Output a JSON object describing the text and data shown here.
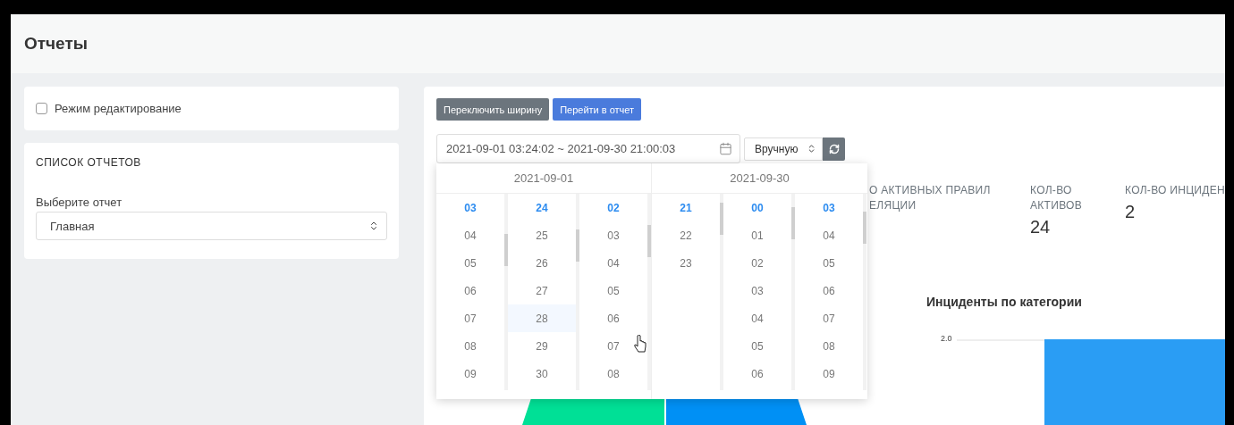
{
  "page": {
    "title": "Отчеты"
  },
  "edit_mode": {
    "label": "Режим редактирование",
    "checked": false
  },
  "report_list": {
    "heading": "СПИСОК ОТЧЕТОВ",
    "select_label": "Выберите отчет",
    "select_value": "Главная"
  },
  "toolbar": {
    "buttons": [
      {
        "label": "Переключить ширину",
        "kind": "secondary"
      },
      {
        "label": "Перейти в отчет",
        "kind": "primary"
      }
    ]
  },
  "date_range": {
    "value": "2021-09-01 03:24:02 ~ 2021-09-30 21:00:03",
    "mode": "Вручную"
  },
  "date_picker": {
    "panes": [
      {
        "date": "2021-09-01",
        "columns": [
          [
            {
              "label": "03",
              "selected": true,
              "hovered": false
            },
            {
              "label": "04",
              "selected": false,
              "hovered": false
            },
            {
              "label": "05",
              "selected": false,
              "hovered": false
            },
            {
              "label": "06",
              "selected": false,
              "hovered": false
            },
            {
              "label": "07",
              "selected": false,
              "hovered": false
            },
            {
              "label": "08",
              "selected": false,
              "hovered": false
            },
            {
              "label": "09",
              "selected": false,
              "hovered": false
            }
          ],
          [
            {
              "label": "24",
              "selected": true,
              "hovered": false
            },
            {
              "label": "25",
              "selected": false,
              "hovered": false
            },
            {
              "label": "26",
              "selected": false,
              "hovered": false
            },
            {
              "label": "27",
              "selected": false,
              "hovered": false
            },
            {
              "label": "28",
              "selected": false,
              "hovered": true
            },
            {
              "label": "29",
              "selected": false,
              "hovered": false
            },
            {
              "label": "30",
              "selected": false,
              "hovered": false
            }
          ],
          [
            {
              "label": "02",
              "selected": true,
              "hovered": false
            },
            {
              "label": "03",
              "selected": false,
              "hovered": false
            },
            {
              "label": "04",
              "selected": false,
              "hovered": false
            },
            {
              "label": "05",
              "selected": false,
              "hovered": false
            },
            {
              "label": "06",
              "selected": false,
              "hovered": false
            },
            {
              "label": "07",
              "selected": false,
              "hovered": false
            },
            {
              "label": "08",
              "selected": false,
              "hovered": false
            }
          ]
        ]
      },
      {
        "date": "2021-09-30",
        "columns": [
          [
            {
              "label": "21",
              "selected": true,
              "hovered": false
            },
            {
              "label": "22",
              "selected": false,
              "hovered": false
            },
            {
              "label": "23",
              "selected": false,
              "hovered": false
            }
          ],
          [
            {
              "label": "00",
              "selected": true,
              "hovered": false
            },
            {
              "label": "01",
              "selected": false,
              "hovered": false
            },
            {
              "label": "02",
              "selected": false,
              "hovered": false
            },
            {
              "label": "03",
              "selected": false,
              "hovered": false
            },
            {
              "label": "04",
              "selected": false,
              "hovered": false
            },
            {
              "label": "05",
              "selected": false,
              "hovered": false
            },
            {
              "label": "06",
              "selected": false,
              "hovered": false
            }
          ],
          [
            {
              "label": "03",
              "selected": true,
              "hovered": false
            },
            {
              "label": "04",
              "selected": false,
              "hovered": false
            },
            {
              "label": "05",
              "selected": false,
              "hovered": false
            },
            {
              "label": "06",
              "selected": false,
              "hovered": false
            },
            {
              "label": "07",
              "selected": false,
              "hovered": false
            },
            {
              "label": "08",
              "selected": false,
              "hovered": false
            },
            {
              "label": "09",
              "selected": false,
              "hovered": false
            }
          ]
        ]
      }
    ]
  },
  "stats": [
    {
      "label": "О АКТИВНЫХ ПРАВИЛ ЕЛЯЦИИ"
    },
    {
      "label": "КОЛ-ВО АКТИВОВ",
      "value": "24"
    },
    {
      "label": "КОЛ-ВО ИНЦИДЕН",
      "value": "2"
    }
  ],
  "bar_chart": {
    "title": "Инциденты по категории",
    "tick": "2.0"
  }
}
